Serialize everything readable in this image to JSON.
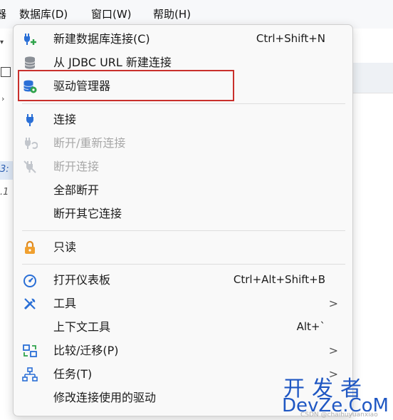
{
  "menubar": {
    "items": [
      {
        "label": "器"
      },
      {
        "label": "数据库(D)"
      },
      {
        "label": "窗口(W)"
      },
      {
        "label": "帮助(H)"
      }
    ]
  },
  "left_pane": {
    "texts": [
      "3:",
      ".1"
    ]
  },
  "menu": {
    "items": [
      {
        "label": "新建数据库连接(C)",
        "shortcut": "Ctrl+Shift+N",
        "icon": "plug-add-icon"
      },
      {
        "label": "从 JDBC URL 新建连接",
        "icon": "database-icon"
      },
      {
        "label": "驱动管理器",
        "icon": "driver-manager-icon"
      },
      {
        "label": "连接",
        "icon": "plug-icon"
      },
      {
        "label": "断开/重新连接",
        "disabled": true,
        "icon": "reconnect-icon"
      },
      {
        "label": "断开连接",
        "disabled": true,
        "icon": "disconnect-icon"
      },
      {
        "label": "全部断开"
      },
      {
        "label": "断开其它连接"
      },
      {
        "label": "只读",
        "icon": "lock-icon"
      },
      {
        "label": "打开仪表板",
        "shortcut": "Ctrl+Alt+Shift+B",
        "icon": "dashboard-icon"
      },
      {
        "label": "工具",
        "submenu": ">",
        "icon": "tools-icon"
      },
      {
        "label": "上下文工具",
        "shortcut": "Alt+`"
      },
      {
        "label": "比较/迁移(P)",
        "submenu": ">",
        "icon": "compare-icon"
      },
      {
        "label": "任务(T)",
        "submenu": ">",
        "icon": "tasks-icon"
      },
      {
        "label": "修改连接使用的驱动"
      }
    ]
  },
  "watermark": {
    "cn": "开发者",
    "en": "DevZe.CoM",
    "faint": "CSDN @chaihuyuanxiao"
  },
  "colors": {
    "highlight_border": "#c9302c",
    "watermark": "#1f57c3",
    "icon_blue": "#2a6fd6"
  }
}
